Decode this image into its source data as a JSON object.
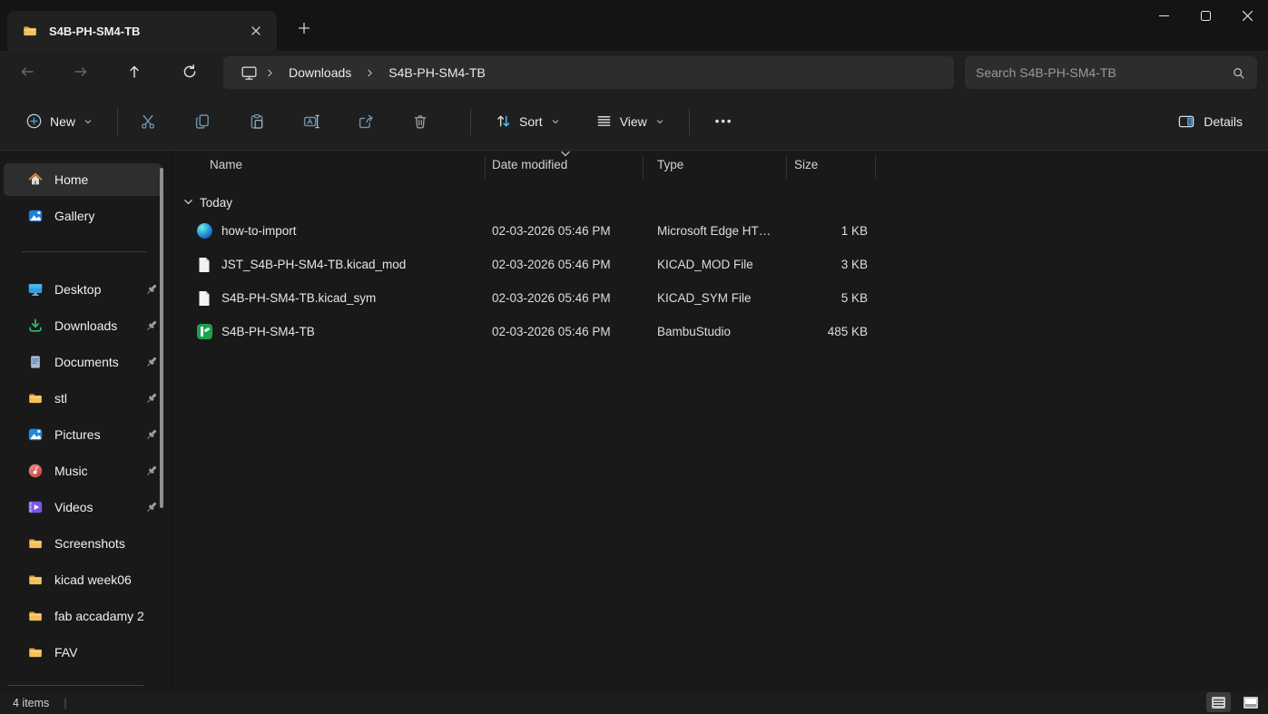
{
  "window": {
    "tab_title": "S4B-PH-SM4-TB",
    "controls": [
      "minimize-icon",
      "maximize-icon",
      "close-icon"
    ]
  },
  "nav": {
    "buttons": [
      "back-arrow",
      "forward-arrow",
      "up-arrow",
      "refresh"
    ],
    "breadcrumb": {
      "root_icon": "this-pc-monitor",
      "items": [
        "Downloads",
        "S4B-PH-SM4-TB"
      ]
    },
    "search_placeholder": "Search S4B-PH-SM4-TB"
  },
  "toolbar": {
    "new_label": "New",
    "icon_buttons": [
      "cut-icon",
      "copy-icon",
      "paste-icon",
      "rename-icon",
      "share-icon",
      "delete-icon"
    ],
    "sort_label": "Sort",
    "view_label": "View",
    "more_label": "•••",
    "details_label": "Details"
  },
  "sidebar": {
    "items": [
      {
        "label": "Home",
        "icon": "home",
        "pinned": false,
        "active": true
      },
      {
        "label": "Gallery",
        "icon": "gallery",
        "pinned": false
      },
      {
        "label": "Desktop",
        "icon": "desktop",
        "pinned": true
      },
      {
        "label": "Downloads",
        "icon": "downloads",
        "pinned": true
      },
      {
        "label": "Documents",
        "icon": "documents",
        "pinned": true
      },
      {
        "label": "stl",
        "icon": "folder",
        "pinned": true
      },
      {
        "label": "Pictures",
        "icon": "pictures",
        "pinned": true
      },
      {
        "label": "Music",
        "icon": "music",
        "pinned": true
      },
      {
        "label": "Videos",
        "icon": "videos",
        "pinned": true
      },
      {
        "label": "Screenshots",
        "icon": "folder",
        "pinned": false
      },
      {
        "label": "kicad week06",
        "icon": "folder",
        "pinned": false
      },
      {
        "label": "fab accadamy 2",
        "icon": "folder",
        "pinned": false
      },
      {
        "label": "FAV",
        "icon": "folder",
        "pinned": false
      }
    ]
  },
  "files": {
    "columns": [
      "Name",
      "Date modified",
      "Type",
      "Size"
    ],
    "sorted_by": "Date modified",
    "group_label": "Today",
    "rows": [
      {
        "name": "how-to-import",
        "date": "02-03-2026 05:46 PM",
        "type": "Microsoft Edge HT…",
        "size": "1 KB",
        "icon": "edge"
      },
      {
        "name": "JST_S4B-PH-SM4-TB.kicad_mod",
        "date": "02-03-2026 05:46 PM",
        "type": "KICAD_MOD File",
        "size": "3 KB",
        "icon": "file"
      },
      {
        "name": "S4B-PH-SM4-TB.kicad_sym",
        "date": "02-03-2026 05:46 PM",
        "type": "KICAD_SYM File",
        "size": "5 KB",
        "icon": "file"
      },
      {
        "name": "S4B-PH-SM4-TB",
        "date": "02-03-2026 05:46 PM",
        "type": "BambuStudio",
        "size": "485 KB",
        "icon": "bambu"
      }
    ]
  },
  "status": {
    "count": "4 items",
    "view_toggles": [
      "details-view",
      "large-icons-view"
    ]
  },
  "colors": {
    "accent_blue": "#4cc2ff",
    "toolbar_icon_blue": "#6d93ab",
    "folder_yellow": "#f3c04f",
    "title_bar": "#141414",
    "bar_bg": "#1f1f1f",
    "content_bg": "#191919",
    "pill_bg": "#2d2d2d"
  }
}
